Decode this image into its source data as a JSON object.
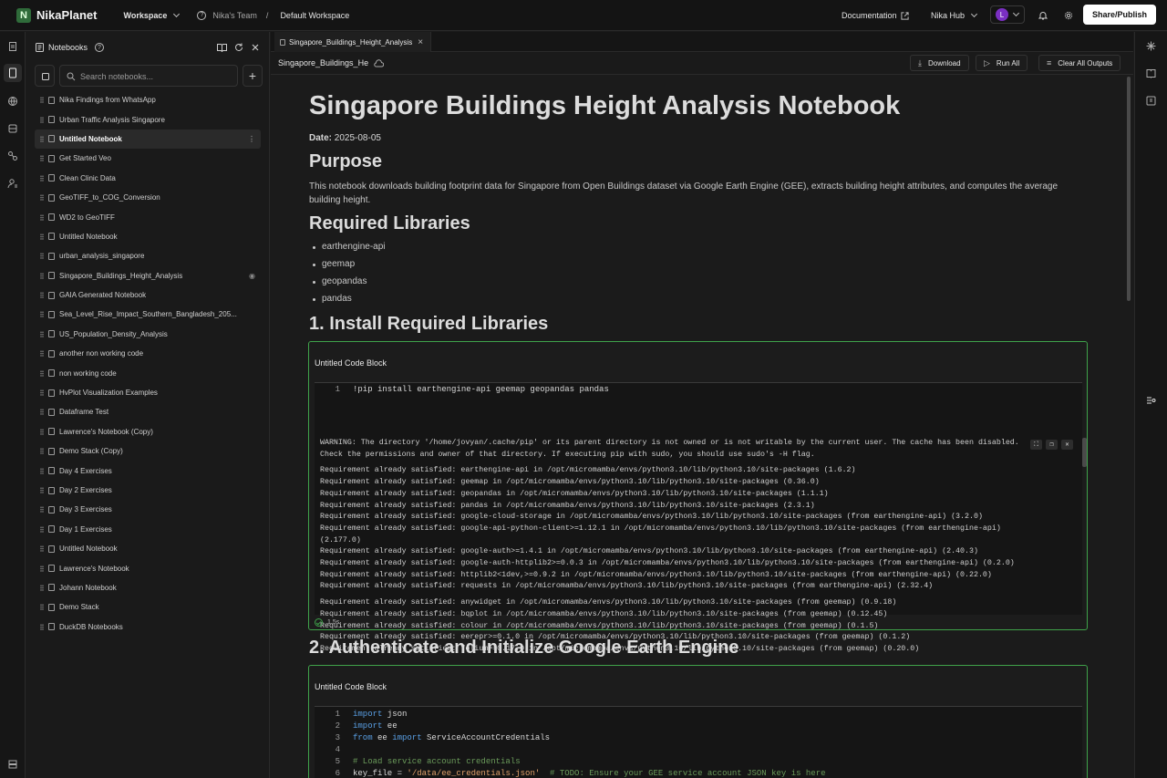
{
  "header": {
    "brand": "NikaPlanet",
    "workspace_label": "Workspace",
    "team": "Nika's Team",
    "separator": "/",
    "current_workspace": "Default Workspace",
    "documentation": "Documentation",
    "hub": "Nika Hub",
    "avatar_initial": "L",
    "share_label": "Share/Publish"
  },
  "sidebar": {
    "title": "Notebooks",
    "search_placeholder": "Search notebooks...",
    "add_label": "+",
    "items": [
      {
        "label": "Nika Findings from WhatsApp"
      },
      {
        "label": "Urban Traffic Analysis Singapore"
      },
      {
        "label": "Untitled Notebook",
        "active": true
      },
      {
        "label": "Get Started Veo"
      },
      {
        "label": "Clean Clinic Data"
      },
      {
        "label": "GeoTIFF_to_COG_Conversion"
      },
      {
        "label": "WD2 to GeoTIFF"
      },
      {
        "label": "Untitled Notebook"
      },
      {
        "label": "urban_analysis_singapore"
      },
      {
        "label": "Singapore_Buildings_Height_Analysis"
      },
      {
        "label": "GAIA Generated Notebook"
      },
      {
        "label": "Sea_Level_Rise_Impact_Southern_Bangladesh_205..."
      },
      {
        "label": "US_Population_Density_Analysis"
      },
      {
        "label": "another non working code"
      },
      {
        "label": "non working code"
      },
      {
        "label": "HvPlot Visualization Examples"
      },
      {
        "label": "Dataframe Test"
      },
      {
        "label": "Lawrence's Notebook (Copy)"
      },
      {
        "label": "Demo Stack (Copy)"
      },
      {
        "label": "Day 4 Exercises"
      },
      {
        "label": "Day 2 Exercises"
      },
      {
        "label": "Day 3 Exercises"
      },
      {
        "label": "Day 1 Exercises"
      },
      {
        "label": "Untitled Notebook"
      },
      {
        "label": "Lawrence's Notebook"
      },
      {
        "label": "Johann Notebook"
      },
      {
        "label": "Demo Stack"
      },
      {
        "label": "DuckDB Notebooks"
      }
    ]
  },
  "tab": {
    "label": "Singapore_Buildings_Height_Analysis"
  },
  "toolbar": {
    "name": "Singapore_Buildings_He",
    "download": "Download",
    "run_all": "Run All",
    "clear_outputs": "Clear All Outputs"
  },
  "notebook": {
    "title": "Singapore Buildings Height Analysis Notebook",
    "date_label": "Date:",
    "date_value": "2025-08-05",
    "purpose_heading": "Purpose",
    "purpose_text": "This notebook downloads building footprint data for Singapore from Open Buildings dataset via Google Earth Engine (GEE), extracts building height attributes, and computes the average building height.",
    "libraries_heading": "Required Libraries",
    "libraries": [
      "earthengine-api",
      "geemap",
      "geopandas",
      "pandas"
    ],
    "section1_heading": "1. Install Required Libraries",
    "cell1": {
      "title": "Untitled Code Block",
      "line_no": "1",
      "code": "!pip install earthengine-api geemap geopandas pandas",
      "output": [
        "WARNING: The directory '/home/jovyan/.cache/pip' or its parent directory is not owned or is not writable by the current user. The cache has been disabled.",
        "Check the permissions and owner of that directory. If executing pip with sudo, you should use sudo's -H flag.",
        "",
        "Requirement already satisfied: earthengine-api in /opt/micromamba/envs/python3.10/lib/python3.10/site-packages (1.6.2)",
        "Requirement already satisfied: geemap in /opt/micromamba/envs/python3.10/lib/python3.10/site-packages (0.36.0)",
        "Requirement already satisfied: geopandas in /opt/micromamba/envs/python3.10/lib/python3.10/site-packages (1.1.1)",
        "Requirement already satisfied: pandas in /opt/micromamba/envs/python3.10/lib/python3.10/site-packages (2.3.1)",
        "Requirement already satisfied: google-cloud-storage in /opt/micromamba/envs/python3.10/lib/python3.10/site-packages (from earthengine-api) (3.2.0)",
        "Requirement already satisfied: google-api-python-client>=1.12.1 in /opt/micromamba/envs/python3.10/lib/python3.10/site-packages (from earthengine-api)",
        "(2.177.0)",
        "Requirement already satisfied: google-auth>=1.4.1 in /opt/micromamba/envs/python3.10/lib/python3.10/site-packages (from earthengine-api) (2.40.3)",
        "Requirement already satisfied: google-auth-httplib2>=0.0.3 in /opt/micromamba/envs/python3.10/lib/python3.10/site-packages (from earthengine-api) (0.2.0)",
        "Requirement already satisfied: httplib2<1dev,>=0.9.2 in /opt/micromamba/envs/python3.10/lib/python3.10/site-packages (from earthengine-api) (0.22.0)",
        "Requirement already satisfied: requests in /opt/micromamba/envs/python3.10/lib/python3.10/site-packages (from earthengine-api) (2.32.4)",
        "",
        "Requirement already satisfied: anywidget in /opt/micromamba/envs/python3.10/lib/python3.10/site-packages (from geemap) (0.9.18)",
        "Requirement already satisfied: bqplot in /opt/micromamba/envs/python3.10/lib/python3.10/site-packages (from geemap) (0.12.45)",
        "Requirement already satisfied: colour in /opt/micromamba/envs/python3.10/lib/python3.10/site-packages (from geemap) (0.1.5)",
        "Requirement already satisfied: eerepr>=0.1.0 in /opt/micromamba/envs/python3.10/lib/python3.10/site-packages (from geemap) (0.1.2)",
        "Requirement already satisfied: folium>=0.17.0 in /opt/micromamba/envs/python3.10/lib/python3.10/site-packages (from geemap) (0.20.0)"
      ],
      "exec_time": "1.5s"
    },
    "section2_heading": "2. Authenticate and Initialize Google Earth Engine",
    "cell2": {
      "title": "Untitled Code Block",
      "lines": [
        {
          "n": "1",
          "kw": "import",
          "rest": " json"
        },
        {
          "n": "2",
          "kw": "import",
          "rest": " ee"
        },
        {
          "n": "3",
          "kw": "from",
          "rest": " ee ",
          "kw2": "import",
          "rest2": " ServiceAccountCredentials"
        },
        {
          "n": "4",
          "kw": "",
          "rest": ""
        },
        {
          "n": "5",
          "comment": "# Load service account credentials"
        },
        {
          "n": "6",
          "plain": "key_file = ",
          "str": "'/data/ee_credentials.json'",
          "comment": "  # TODO: Ensure your GEE service account JSON key is here"
        }
      ]
    }
  }
}
